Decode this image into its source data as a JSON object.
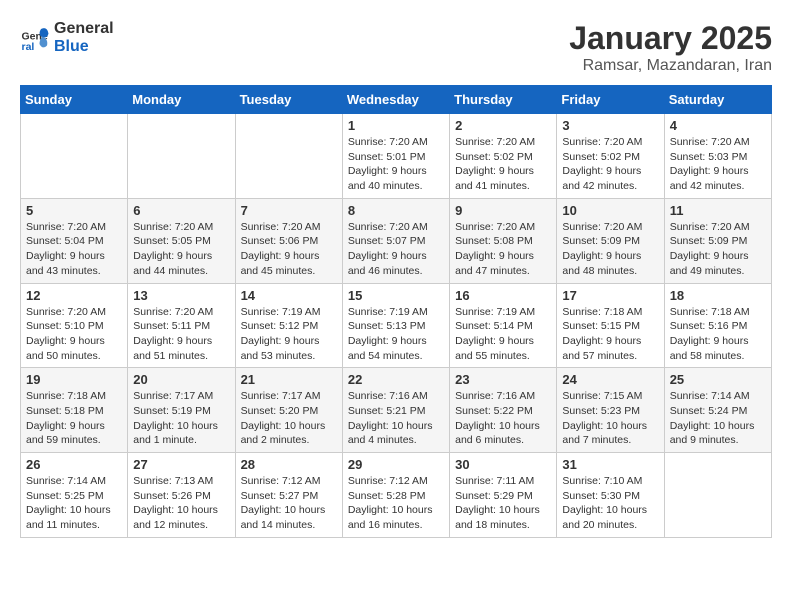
{
  "header": {
    "logo_general": "General",
    "logo_blue": "Blue",
    "month_title": "January 2025",
    "subtitle": "Ramsar, Mazandaran, Iran"
  },
  "weekdays": [
    "Sunday",
    "Monday",
    "Tuesday",
    "Wednesday",
    "Thursday",
    "Friday",
    "Saturday"
  ],
  "weeks": [
    [
      {
        "day": "",
        "info": ""
      },
      {
        "day": "",
        "info": ""
      },
      {
        "day": "",
        "info": ""
      },
      {
        "day": "1",
        "info": "Sunrise: 7:20 AM\nSunset: 5:01 PM\nDaylight: 9 hours\nand 40 minutes."
      },
      {
        "day": "2",
        "info": "Sunrise: 7:20 AM\nSunset: 5:02 PM\nDaylight: 9 hours\nand 41 minutes."
      },
      {
        "day": "3",
        "info": "Sunrise: 7:20 AM\nSunset: 5:02 PM\nDaylight: 9 hours\nand 42 minutes."
      },
      {
        "day": "4",
        "info": "Sunrise: 7:20 AM\nSunset: 5:03 PM\nDaylight: 9 hours\nand 42 minutes."
      }
    ],
    [
      {
        "day": "5",
        "info": "Sunrise: 7:20 AM\nSunset: 5:04 PM\nDaylight: 9 hours\nand 43 minutes."
      },
      {
        "day": "6",
        "info": "Sunrise: 7:20 AM\nSunset: 5:05 PM\nDaylight: 9 hours\nand 44 minutes."
      },
      {
        "day": "7",
        "info": "Sunrise: 7:20 AM\nSunset: 5:06 PM\nDaylight: 9 hours\nand 45 minutes."
      },
      {
        "day": "8",
        "info": "Sunrise: 7:20 AM\nSunset: 5:07 PM\nDaylight: 9 hours\nand 46 minutes."
      },
      {
        "day": "9",
        "info": "Sunrise: 7:20 AM\nSunset: 5:08 PM\nDaylight: 9 hours\nand 47 minutes."
      },
      {
        "day": "10",
        "info": "Sunrise: 7:20 AM\nSunset: 5:09 PM\nDaylight: 9 hours\nand 48 minutes."
      },
      {
        "day": "11",
        "info": "Sunrise: 7:20 AM\nSunset: 5:09 PM\nDaylight: 9 hours\nand 49 minutes."
      }
    ],
    [
      {
        "day": "12",
        "info": "Sunrise: 7:20 AM\nSunset: 5:10 PM\nDaylight: 9 hours\nand 50 minutes."
      },
      {
        "day": "13",
        "info": "Sunrise: 7:20 AM\nSunset: 5:11 PM\nDaylight: 9 hours\nand 51 minutes."
      },
      {
        "day": "14",
        "info": "Sunrise: 7:19 AM\nSunset: 5:12 PM\nDaylight: 9 hours\nand 53 minutes."
      },
      {
        "day": "15",
        "info": "Sunrise: 7:19 AM\nSunset: 5:13 PM\nDaylight: 9 hours\nand 54 minutes."
      },
      {
        "day": "16",
        "info": "Sunrise: 7:19 AM\nSunset: 5:14 PM\nDaylight: 9 hours\nand 55 minutes."
      },
      {
        "day": "17",
        "info": "Sunrise: 7:18 AM\nSunset: 5:15 PM\nDaylight: 9 hours\nand 57 minutes."
      },
      {
        "day": "18",
        "info": "Sunrise: 7:18 AM\nSunset: 5:16 PM\nDaylight: 9 hours\nand 58 minutes."
      }
    ],
    [
      {
        "day": "19",
        "info": "Sunrise: 7:18 AM\nSunset: 5:18 PM\nDaylight: 9 hours\nand 59 minutes."
      },
      {
        "day": "20",
        "info": "Sunrise: 7:17 AM\nSunset: 5:19 PM\nDaylight: 10 hours\nand 1 minute."
      },
      {
        "day": "21",
        "info": "Sunrise: 7:17 AM\nSunset: 5:20 PM\nDaylight: 10 hours\nand 2 minutes."
      },
      {
        "day": "22",
        "info": "Sunrise: 7:16 AM\nSunset: 5:21 PM\nDaylight: 10 hours\nand 4 minutes."
      },
      {
        "day": "23",
        "info": "Sunrise: 7:16 AM\nSunset: 5:22 PM\nDaylight: 10 hours\nand 6 minutes."
      },
      {
        "day": "24",
        "info": "Sunrise: 7:15 AM\nSunset: 5:23 PM\nDaylight: 10 hours\nand 7 minutes."
      },
      {
        "day": "25",
        "info": "Sunrise: 7:14 AM\nSunset: 5:24 PM\nDaylight: 10 hours\nand 9 minutes."
      }
    ],
    [
      {
        "day": "26",
        "info": "Sunrise: 7:14 AM\nSunset: 5:25 PM\nDaylight: 10 hours\nand 11 minutes."
      },
      {
        "day": "27",
        "info": "Sunrise: 7:13 AM\nSunset: 5:26 PM\nDaylight: 10 hours\nand 12 minutes."
      },
      {
        "day": "28",
        "info": "Sunrise: 7:12 AM\nSunset: 5:27 PM\nDaylight: 10 hours\nand 14 minutes."
      },
      {
        "day": "29",
        "info": "Sunrise: 7:12 AM\nSunset: 5:28 PM\nDaylight: 10 hours\nand 16 minutes."
      },
      {
        "day": "30",
        "info": "Sunrise: 7:11 AM\nSunset: 5:29 PM\nDaylight: 10 hours\nand 18 minutes."
      },
      {
        "day": "31",
        "info": "Sunrise: 7:10 AM\nSunset: 5:30 PM\nDaylight: 10 hours\nand 20 minutes."
      },
      {
        "day": "",
        "info": ""
      }
    ]
  ]
}
